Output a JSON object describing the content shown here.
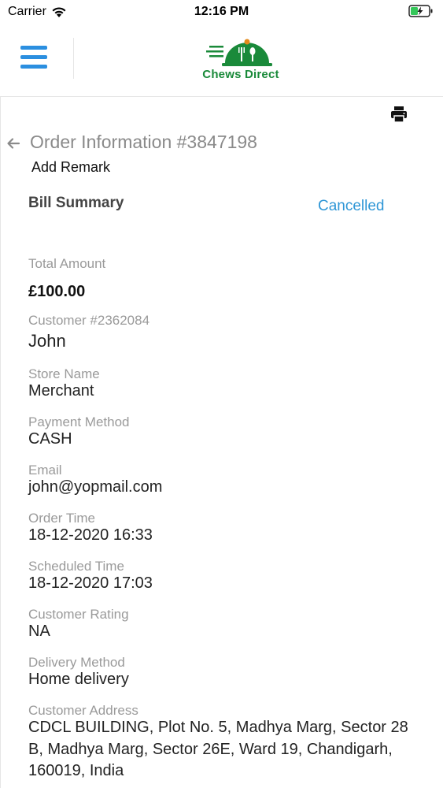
{
  "status_bar": {
    "carrier": "Carrier",
    "time": "12:16 PM"
  },
  "header": {
    "logo_text": "Chews Direct",
    "brand_color": "#1a8a3a",
    "accent_color": "#2b8fe0"
  },
  "order": {
    "title": "Order Information #3847198",
    "add_remark": "Add Remark",
    "bill_summary": "Bill Summary",
    "status": "Cancelled"
  },
  "fields": {
    "total_amount": {
      "label": "Total Amount",
      "value": "£100.00"
    },
    "customer": {
      "label": "Customer #2362084",
      "value": "John"
    },
    "store_name": {
      "label": "Store Name",
      "value": "Merchant"
    },
    "payment_method": {
      "label": "Payment Method",
      "value": "CASH"
    },
    "email": {
      "label": "Email",
      "value": "john@yopmail.com"
    },
    "order_time": {
      "label": "Order Time",
      "value": "18-12-2020 16:33"
    },
    "scheduled_time": {
      "label": "Scheduled Time",
      "value": "18-12-2020 17:03"
    },
    "customer_rating": {
      "label": "Customer Rating",
      "value": "NA"
    },
    "delivery_method": {
      "label": "Delivery Method",
      "value": "Home delivery"
    },
    "customer_address": {
      "label": "Customer Address",
      "value": "CDCL BUILDING, Plot No. 5, Madhya Marg, Sector 28 B, Madhya Marg, Sector 26E, Ward 19, Chandigarh, 160019, India"
    }
  },
  "icons": {
    "menu": "hamburger-menu-icon",
    "print": "printer-icon",
    "back": "arrow-left-icon"
  }
}
